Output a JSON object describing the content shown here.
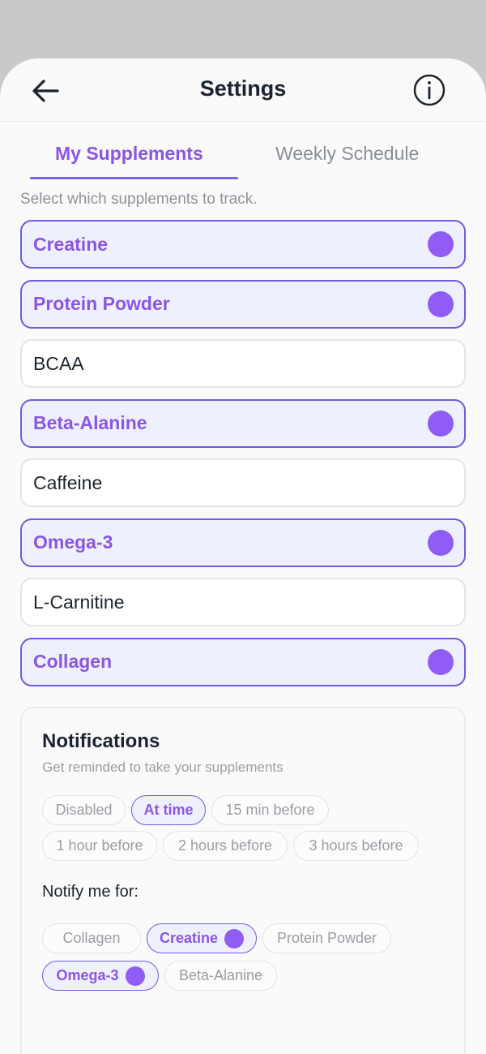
{
  "header": {
    "title": "Settings"
  },
  "tabs": [
    {
      "label": "My Supplements",
      "active": true
    },
    {
      "label": "Weekly Schedule",
      "active": false
    }
  ],
  "hint": "Select which supplements to track.",
  "supplements": [
    {
      "name": "Creatine",
      "selected": true
    },
    {
      "name": "Protein Powder",
      "selected": true
    },
    {
      "name": "BCAA",
      "selected": false
    },
    {
      "name": "Beta-Alanine",
      "selected": true
    },
    {
      "name": "Caffeine",
      "selected": false
    },
    {
      "name": "Omega-3",
      "selected": true
    },
    {
      "name": "L-Carnitine",
      "selected": false
    },
    {
      "name": "Collagen",
      "selected": true
    }
  ],
  "notifications": {
    "title": "Notifications",
    "subtitle": "Get reminded to take your supplements",
    "timing_options": [
      {
        "label": "Disabled",
        "active": false
      },
      {
        "label": "At time",
        "active": true
      },
      {
        "label": "15 min before",
        "active": false
      },
      {
        "label": "1 hour before",
        "active": false
      },
      {
        "label": "2 hours before",
        "active": false
      },
      {
        "label": "3 hours before",
        "active": false
      }
    ],
    "notify_label": "Notify me for:",
    "notify_options": [
      {
        "label": "Collagen",
        "active": false
      },
      {
        "label": "Creatine",
        "active": true
      },
      {
        "label": "Protein Powder",
        "active": false
      },
      {
        "label": "Omega-3",
        "active": true
      },
      {
        "label": "Beta-Alanine",
        "active": false
      }
    ]
  },
  "colors": {
    "accent": "#8a55e8",
    "accent_border": "#6c5ce0",
    "dot": "#8f5cf5",
    "selected_bg": "#eef1fd"
  }
}
